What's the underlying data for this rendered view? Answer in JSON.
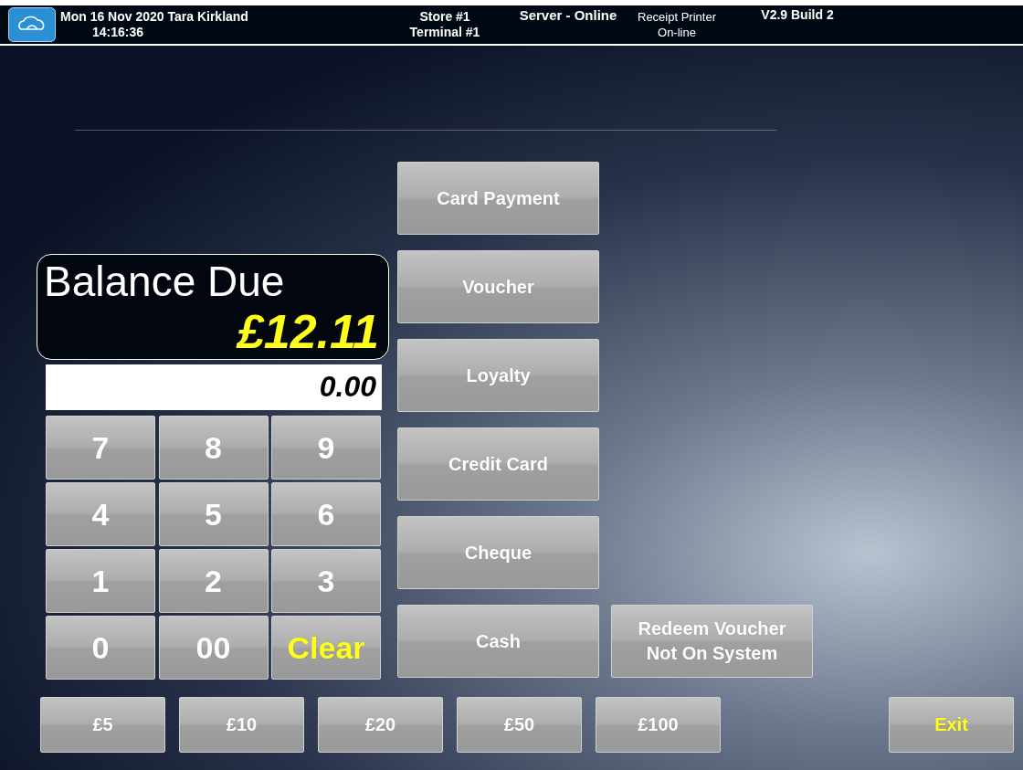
{
  "header": {
    "date_user": "Mon 16 Nov 2020 Tara Kirkland",
    "time": "14:16:36",
    "store": "Store #1",
    "terminal": "Terminal #1",
    "server_status": "Server - Online",
    "printer": "Receipt Printer",
    "printer_status": "On-line",
    "version": "V2.9 Build 2"
  },
  "balance": {
    "label": "Balance Due",
    "amount": "£12.11"
  },
  "entry": {
    "value": "0.00"
  },
  "keypad": [
    {
      "label": "7",
      "kind": "digit"
    },
    {
      "label": "8",
      "kind": "digit"
    },
    {
      "label": "9",
      "kind": "digit"
    },
    {
      "label": "4",
      "kind": "digit"
    },
    {
      "label": "5",
      "kind": "digit"
    },
    {
      "label": "6",
      "kind": "digit"
    },
    {
      "label": "1",
      "kind": "digit"
    },
    {
      "label": "2",
      "kind": "digit"
    },
    {
      "label": "3",
      "kind": "digit"
    },
    {
      "label": "0",
      "kind": "digit"
    },
    {
      "label": "00",
      "kind": "digit"
    },
    {
      "label": "Clear",
      "kind": "clear"
    }
  ],
  "payment_methods": [
    "Card Payment",
    "Voucher",
    "Loyalty",
    "Credit Card",
    "Cheque",
    "Cash"
  ],
  "redeem_button": [
    "Redeem Voucher",
    "Not On System"
  ],
  "quick_amounts": [
    "£5",
    "£10",
    "£20",
    "£50",
    "£100"
  ],
  "exit_button": "Exit"
}
